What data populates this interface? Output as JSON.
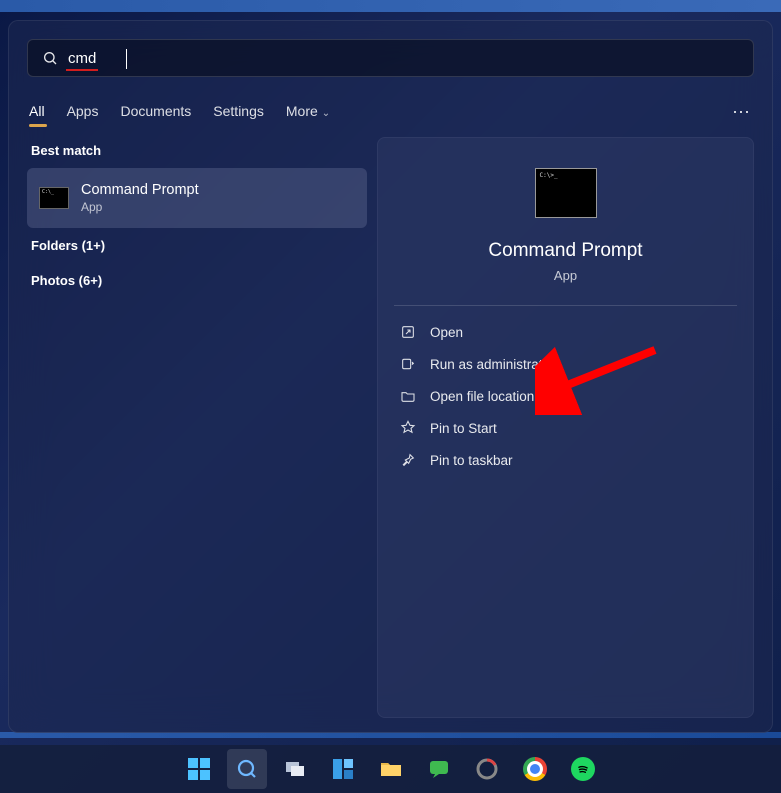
{
  "search": {
    "value": "cmd"
  },
  "tabs": {
    "all": "All",
    "apps": "Apps",
    "documents": "Documents",
    "settings": "Settings",
    "more": "More"
  },
  "left": {
    "best_match_label": "Best match",
    "best_match": {
      "title": "Command Prompt",
      "subtitle": "App"
    },
    "folders_label": "Folders (1+)",
    "photos_label": "Photos (6+)"
  },
  "detail": {
    "title": "Command Prompt",
    "subtitle": "App",
    "actions": {
      "open": "Open",
      "run_admin": "Run as administrator",
      "open_loc": "Open file location",
      "pin_start": "Pin to Start",
      "pin_taskbar": "Pin to taskbar"
    }
  }
}
